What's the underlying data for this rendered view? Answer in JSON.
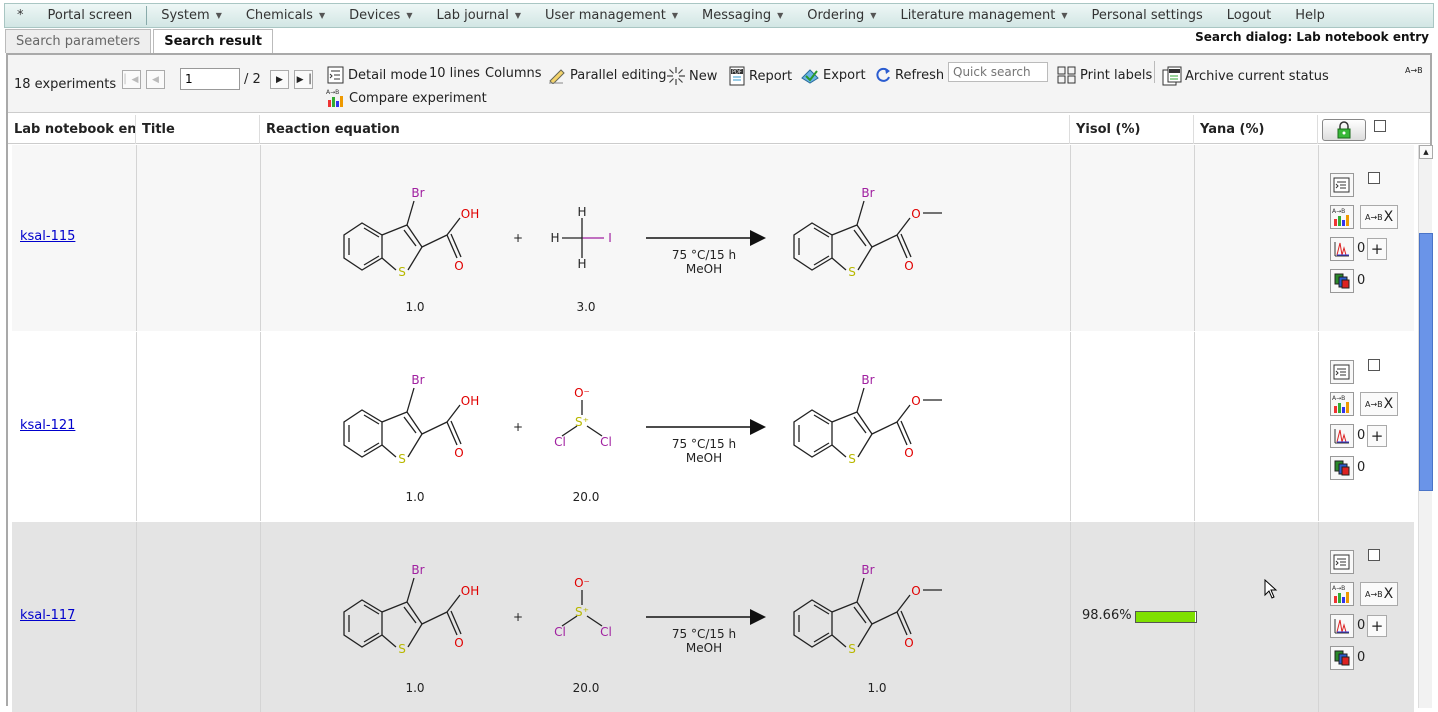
{
  "menu": {
    "items": [
      {
        "label": "*",
        "has_caret": false
      },
      {
        "label": "Portal screen",
        "has_caret": false
      },
      {
        "label": "System",
        "has_caret": true
      },
      {
        "label": "Chemicals",
        "has_caret": true
      },
      {
        "label": "Devices",
        "has_caret": true
      },
      {
        "label": "Lab journal",
        "has_caret": true
      },
      {
        "label": "User management",
        "has_caret": true
      },
      {
        "label": "Messaging",
        "has_caret": true
      },
      {
        "label": "Ordering",
        "has_caret": true
      },
      {
        "label": "Literature management",
        "has_caret": true
      },
      {
        "label": "Personal settings",
        "has_caret": false
      },
      {
        "label": "Logout",
        "has_caret": false
      },
      {
        "label": "Help",
        "has_caret": false
      }
    ]
  },
  "tabs": [
    {
      "label": "Search parameters",
      "active": false
    },
    {
      "label": "Search result",
      "active": true
    }
  ],
  "dialog_title": "Search dialog: Lab notebook entry",
  "toolbar": {
    "experiment_count": "18 experiments",
    "page_value": "1",
    "page_total": "/ 2",
    "detail_mode": "Detail mode",
    "lines": "10 lines",
    "columns": "Columns",
    "parallel_editing": "Parallel editing",
    "new": "New",
    "report": "Report",
    "export": "Export",
    "refresh": "Refresh",
    "quick_search_placeholder": "Quick search",
    "print_labels": "Print labels",
    "archive_status": "Archive current status",
    "compare_experiment": "Compare experiment",
    "abbr_icon_label": "A→B"
  },
  "columns": {
    "entry": "Lab notebook entry",
    "title": "Title",
    "equation": "Reaction equation",
    "yisol": "Yisol (%)",
    "yana": "Yana (%)"
  },
  "icons": {
    "detail": "detail-mode-icon",
    "parallel": "pencil-icon",
    "new": "sparkle-icon",
    "report": "pdf-icon",
    "export": "export-icon",
    "refresh": "refresh-icon",
    "print": "barcode-icon",
    "archive": "archive-pdf-icon",
    "compare": "compare-chart-icon",
    "lock": "lock-icon"
  },
  "mol_labels": {
    "br": "Br",
    "oh": "OH",
    "o": "O",
    "s": "S",
    "h": "H",
    "i": "I",
    "cl": "Cl",
    "o_minus": "O⁻",
    "s_plus": "S⁺",
    "plus": "+"
  },
  "action_icon_text": "A→B",
  "rows": [
    {
      "entry": "ksal-115",
      "conditions_1": "75 °C/15 h",
      "conditions_2": "MeOH",
      "coef_1": "1.0",
      "coef_2": "3.0",
      "product_coef": "",
      "reagent": "methyl iodide",
      "yisol_text": "",
      "yisol_value": null,
      "spectra_count": "0",
      "samples_count": "0",
      "close_label": "X",
      "add_label": "+"
    },
    {
      "entry": "ksal-121",
      "conditions_1": "75 °C/15 h",
      "conditions_2": "MeOH",
      "coef_1": "1.0",
      "coef_2": "20.0",
      "product_coef": "",
      "reagent": "thionyl chloride",
      "yisol_text": "",
      "yisol_value": null,
      "spectra_count": "0",
      "samples_count": "0",
      "close_label": "X",
      "add_label": "+"
    },
    {
      "entry": "ksal-117",
      "conditions_1": "75 °C/15 h",
      "conditions_2": "MeOH",
      "coef_1": "1.0",
      "coef_2": "20.0",
      "product_coef": "1.0",
      "reagent": "thionyl chloride",
      "yisol_text": "98.66%",
      "yisol_value": 98.66,
      "spectra_count": "0",
      "samples_count": "0",
      "close_label": "X",
      "add_label": "+"
    }
  ]
}
